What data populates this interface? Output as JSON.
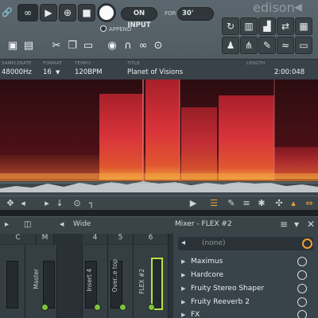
{
  "top": {
    "on_input": "ON INPUT",
    "for_label": "FOR",
    "duration_value": "30'",
    "append_label": "APPEND",
    "brand": "edison"
  },
  "info": {
    "samplerate_label": "SAMPLERATE",
    "samplerate_value": "48000Hz",
    "format_label": "FORMAT",
    "format_value": "16",
    "tempo_label": "TEMPO",
    "tempo_value": "120BPM",
    "title_label": "TITLE",
    "title_value": "Planet of Visions",
    "length_label": "LENGTH",
    "time_value": "2:00:048"
  },
  "mixer": {
    "wide_label": "Wide",
    "title": "Mixer - FLEX #2",
    "slot_value": "(none)",
    "channels": [
      {
        "header": "C"
      },
      {
        "header": "M",
        "name": "Master"
      },
      {
        "header": "4",
        "name": "Insert 4"
      },
      {
        "header": "5",
        "name": "Over..e top"
      },
      {
        "header": "6",
        "name": "FLEX #2"
      }
    ],
    "effects": [
      "Maximus",
      "Hardcore",
      "Fruity Stereo Shaper",
      "Fruity Reeverb 2",
      "FX"
    ]
  },
  "colors": {
    "spectrum_hot": "#d8333a",
    "spectrum_warm": "#f0a040",
    "selected_channel": "#b8e040",
    "accent_orange": "#f0a030"
  }
}
